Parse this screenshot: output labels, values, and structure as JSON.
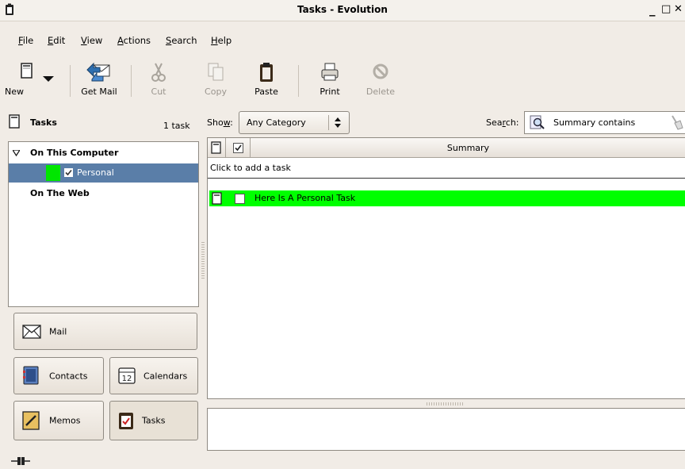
{
  "window": {
    "title": "Tasks - Evolution",
    "minimize_glyph": "_",
    "maximize_glyph": "□",
    "close_glyph": "✕"
  },
  "menus": [
    {
      "pre": "",
      "u": "F",
      "post": "ile"
    },
    {
      "pre": "",
      "u": "E",
      "post": "dit"
    },
    {
      "pre": "",
      "u": "V",
      "post": "iew"
    },
    {
      "pre": "",
      "u": "A",
      "post": "ctions"
    },
    {
      "pre": "",
      "u": "S",
      "post": "earch"
    },
    {
      "pre": "",
      "u": "H",
      "post": "elp"
    }
  ],
  "toolbar": {
    "new": "New",
    "get_mail": "Get Mail",
    "cut": "Cut",
    "copy": "Copy",
    "paste": "Paste",
    "print": "Print",
    "delete": "Delete"
  },
  "sidebar": {
    "header_title": "Tasks",
    "header_count": "1 task",
    "groups": {
      "on_this_computer": "On This Computer",
      "personal": "Personal",
      "on_the_web": "On The Web"
    },
    "personal_color": "#00e600",
    "switcher": {
      "mail": "Mail",
      "contacts": "Contacts",
      "calendars": "Calendars",
      "memos": "Memos",
      "tasks": "Tasks"
    }
  },
  "filter": {
    "show_label_pre": "Sho",
    "show_label_u": "w",
    "show_label_post": ":",
    "category_value": "Any Category",
    "search_label_pre": "Sea",
    "search_label_u": "r",
    "search_label_post": "ch:",
    "search_mode": "Summary contains"
  },
  "table": {
    "column_summary": "Summary",
    "add_placeholder": "Click to add a task",
    "rows": [
      {
        "summary": "Here Is A Personal Task",
        "highlight": "#00ff00"
      }
    ]
  },
  "colors": {
    "selection": "#5a7ea8",
    "task_highlight": "#00ff00"
  }
}
